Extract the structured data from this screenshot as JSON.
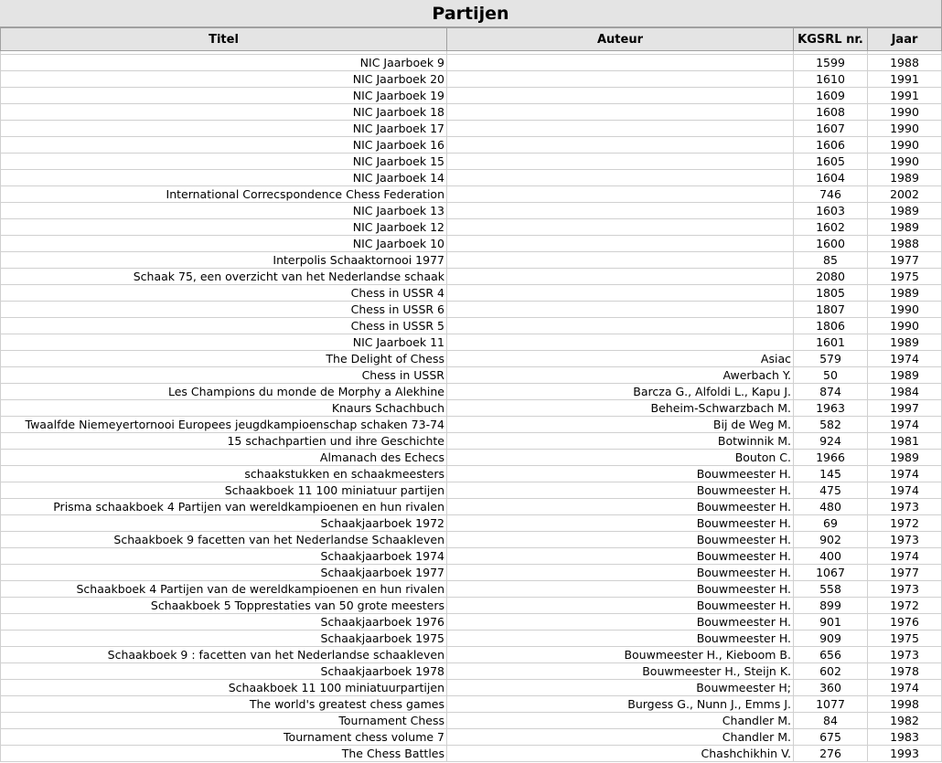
{
  "sheet": {
    "title": "Partijen",
    "columns": [
      "Titel",
      "Auteur",
      "KGSRL nr.",
      "Jaar"
    ],
    "rows": [
      {
        "titel": "NIC Jaarboek 9",
        "auteur": "",
        "nr": "1599",
        "jaar": "1988"
      },
      {
        "titel": "NIC Jaarboek 20",
        "auteur": "",
        "nr": "1610",
        "jaar": "1991"
      },
      {
        "titel": "NIC Jaarboek 19",
        "auteur": "",
        "nr": "1609",
        "jaar": "1991"
      },
      {
        "titel": "NIC Jaarboek 18",
        "auteur": "",
        "nr": "1608",
        "jaar": "1990"
      },
      {
        "titel": "NIC Jaarboek 17",
        "auteur": "",
        "nr": "1607",
        "jaar": "1990"
      },
      {
        "titel": "NIC Jaarboek 16",
        "auteur": "",
        "nr": "1606",
        "jaar": "1990"
      },
      {
        "titel": "NIC Jaarboek 15",
        "auteur": "",
        "nr": "1605",
        "jaar": "1990"
      },
      {
        "titel": "NIC Jaarboek 14",
        "auteur": "",
        "nr": "1604",
        "jaar": "1989"
      },
      {
        "titel": "International Correcspondence Chess Federation",
        "auteur": "",
        "nr": "746",
        "jaar": "2002"
      },
      {
        "titel": "NIC Jaarboek 13",
        "auteur": "",
        "nr": "1603",
        "jaar": "1989"
      },
      {
        "titel": "NIC Jaarboek 12",
        "auteur": "",
        "nr": "1602",
        "jaar": "1989"
      },
      {
        "titel": "NIC Jaarboek 10",
        "auteur": "",
        "nr": "1600",
        "jaar": "1988"
      },
      {
        "titel": "Interpolis Schaaktornooi 1977",
        "auteur": "",
        "nr": "85",
        "jaar": "1977"
      },
      {
        "titel": "Schaak 75, een overzicht van het Nederlandse schaak",
        "auteur": "",
        "nr": "2080",
        "jaar": "1975"
      },
      {
        "titel": "Chess in USSR 4",
        "auteur": "",
        "nr": "1805",
        "jaar": "1989"
      },
      {
        "titel": "Chess in USSR 6",
        "auteur": "",
        "nr": "1807",
        "jaar": "1990"
      },
      {
        "titel": "Chess in USSR 5",
        "auteur": "",
        "nr": "1806",
        "jaar": "1990"
      },
      {
        "titel": "NIC Jaarboek 11",
        "auteur": "",
        "nr": "1601",
        "jaar": "1989"
      },
      {
        "titel": "The Delight of Chess",
        "auteur": "Asiac",
        "nr": "579",
        "jaar": "1974"
      },
      {
        "titel": "Chess in USSR",
        "auteur": "Awerbach Y.",
        "nr": "50",
        "jaar": "1989"
      },
      {
        "titel": "Les Champions du monde de Morphy a Alekhine",
        "auteur": "Barcza G., Alfoldi L., Kapu J.",
        "nr": "874",
        "jaar": "1984"
      },
      {
        "titel": "Knaurs Schachbuch",
        "auteur": "Beheim-Schwarzbach M.",
        "nr": "1963",
        "jaar": "1997"
      },
      {
        "titel": "Twaalfde Niemeyertornooi Europees jeugdkampioenschap schaken 73-74",
        "auteur": "Bij de Weg M.",
        "nr": "582",
        "jaar": "1974"
      },
      {
        "titel": "15 schachpartien und ihre Geschichte",
        "auteur": "Botwinnik M.",
        "nr": "924",
        "jaar": "1981"
      },
      {
        "titel": "Almanach des Echecs",
        "auteur": "Bouton C.",
        "nr": "1966",
        "jaar": "1989"
      },
      {
        "titel": "schaakstukken en schaakmeesters",
        "auteur": "Bouwmeester H.",
        "nr": "145",
        "jaar": "1974"
      },
      {
        "titel": "Schaakboek 11 100 miniatuur partijen",
        "auteur": "Bouwmeester H.",
        "nr": "475",
        "jaar": "1974"
      },
      {
        "titel": "Prisma schaakboek 4 Partijen van wereldkampioenen en hun rivalen",
        "auteur": "Bouwmeester H.",
        "nr": "480",
        "jaar": "1973"
      },
      {
        "titel": "Schaakjaarboek 1972",
        "auteur": "Bouwmeester H.",
        "nr": "69",
        "jaar": "1972"
      },
      {
        "titel": "Schaakboek 9 facetten van het Nederlandse Schaakleven",
        "auteur": "Bouwmeester H.",
        "nr": "902",
        "jaar": "1973"
      },
      {
        "titel": "Schaakjaarboek 1974",
        "auteur": "Bouwmeester H.",
        "nr": "400",
        "jaar": "1974"
      },
      {
        "titel": "Schaakjaarboek 1977",
        "auteur": "Bouwmeester H.",
        "nr": "1067",
        "jaar": "1977"
      },
      {
        "titel": "Schaakboek 4 Partijen van de wereldkampioenen en hun rivalen",
        "auteur": "Bouwmeester H.",
        "nr": "558",
        "jaar": "1973"
      },
      {
        "titel": "Schaakboek 5 Topprestaties van 50 grote meesters",
        "auteur": "Bouwmeester H.",
        "nr": "899",
        "jaar": "1972"
      },
      {
        "titel": "Schaakjaarboek 1976",
        "auteur": "Bouwmeester H.",
        "nr": "901",
        "jaar": "1976"
      },
      {
        "titel": "Schaakjaarboek 1975",
        "auteur": "Bouwmeester H.",
        "nr": "909",
        "jaar": "1975"
      },
      {
        "titel": "Schaakboek 9 : facetten van het Nederlandse schaakleven",
        "auteur": "Bouwmeester H., Kieboom B.",
        "nr": "656",
        "jaar": "1973"
      },
      {
        "titel": "Schaakjaarboek 1978",
        "auteur": "Bouwmeester H., Steijn K.",
        "nr": "602",
        "jaar": "1978"
      },
      {
        "titel": "Schaakboek 11 100 miniatuurpartijen",
        "auteur": "Bouwmeester H;",
        "nr": "360",
        "jaar": "1974"
      },
      {
        "titel": "The world's greatest chess games",
        "auteur": "Burgess G., Nunn J., Emms J.",
        "nr": "1077",
        "jaar": "1998"
      },
      {
        "titel": "Tournament Chess",
        "auteur": "Chandler M.",
        "nr": "84",
        "jaar": "1982"
      },
      {
        "titel": "Tournament chess volume 7",
        "auteur": "Chandler M.",
        "nr": "675",
        "jaar": "1983"
      },
      {
        "titel": "The Chess Battles",
        "auteur": "Chashchikhin V.",
        "nr": "276",
        "jaar": "1993"
      }
    ]
  }
}
